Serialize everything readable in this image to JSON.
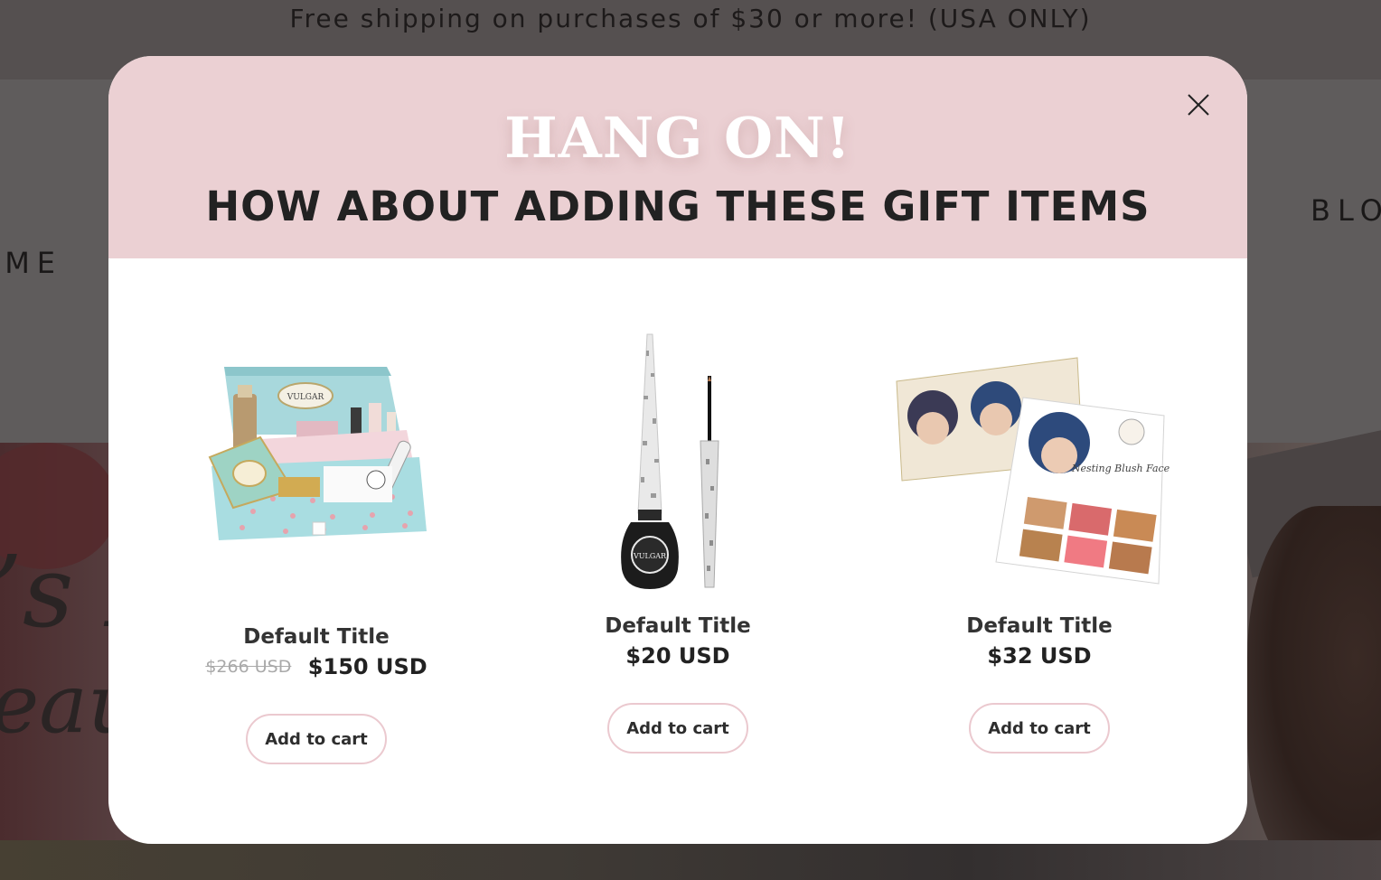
{
  "announcement": {
    "text": "Free shipping on purchases of $30 or more! (USA ONLY)"
  },
  "background_nav": {
    "left_item": "OME",
    "right_item": "BLO",
    "partial_item": "S"
  },
  "hero": {
    "script_line_1": "’s M",
    "script_line_2": "eau"
  },
  "modal": {
    "title": "HANG ON!",
    "subtitle": "HOW ABOUT ADDING THESE GIFT ITEMS",
    "close_icon": "close-icon",
    "products": [
      {
        "title": "Default Title",
        "compare_price": "$266 USD",
        "price": "$150 USD",
        "button": "Add to cart",
        "image": "gift-box-image"
      },
      {
        "title": "Default Title",
        "price": "$20 USD",
        "button": "Add to cart",
        "image": "eyeliner-image"
      },
      {
        "title": "Default Title",
        "price": "$32 USD",
        "button": "Add to cart",
        "image": "blush-palette-image",
        "palette_text": "Nesting Blush Face"
      }
    ]
  },
  "colors": {
    "header_pink": "#ebd0d3",
    "button_border": "#ebc9cf",
    "overlay": "#5e5a5a"
  }
}
